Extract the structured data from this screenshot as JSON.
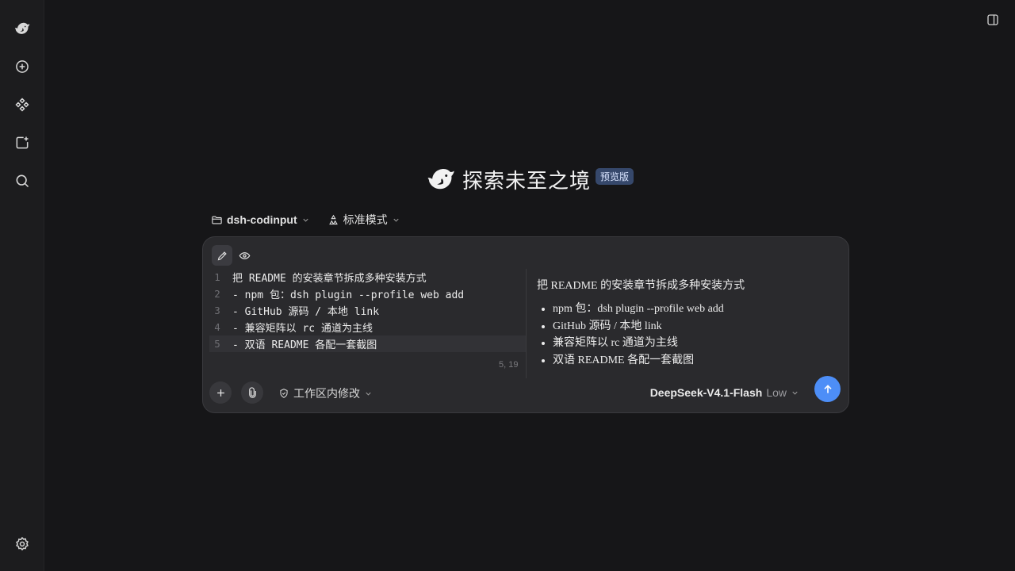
{
  "sidebar": {
    "logo": "whale-logo-icon",
    "items": [
      {
        "icon": "new-chat-icon"
      },
      {
        "icon": "plugin-icon"
      },
      {
        "icon": "new-project-icon"
      },
      {
        "icon": "search-icon"
      }
    ],
    "footer": {
      "icon": "settings-icon"
    }
  },
  "header": {
    "toggle_icon": "sidebar-toggle-icon"
  },
  "hero": {
    "title": "探索未至之境",
    "badge": "预览版"
  },
  "selectors": {
    "project": "dsh-codinput",
    "mode": "标准模式"
  },
  "composer": {
    "editor_lines": [
      {
        "num": "1",
        "text": "把 README 的安装章节拆成多种安装方式"
      },
      {
        "num": "2",
        "text": "- npm 包：dsh plugin --profile web add"
      },
      {
        "num": "3",
        "text": "- GitHub 源码 / 本地 link"
      },
      {
        "num": "4",
        "text": "- 兼容矩阵以 rc 通道为主线"
      },
      {
        "num": "5",
        "text": "- 双语 README 各配一套截图"
      }
    ],
    "cursor_pos": "5, 19",
    "preview": {
      "paragraph": "把 README 的安装章节拆成多种安装方式",
      "items": [
        "npm 包：dsh plugin --profile web add",
        "GitHub 源码 / 本地 link",
        "兼容矩阵以 rc 通道为主线",
        "双语 README 各配一套截图"
      ]
    },
    "workspace_mode": "工作区内修改",
    "model": "DeepSeek-V4.1-Flash",
    "effort": "Low"
  },
  "colors": {
    "accent": "#4d8ef7",
    "background": "#161618",
    "badge_bg": "#36486b"
  }
}
